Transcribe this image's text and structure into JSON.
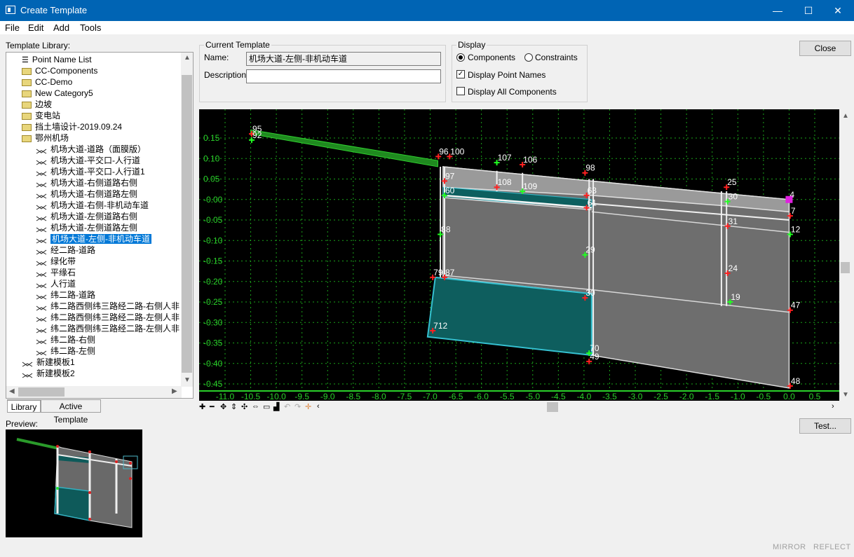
{
  "window": {
    "title": "Create Template",
    "minimize": "—",
    "maximize": "☐",
    "close": "✕"
  },
  "menu": [
    "File",
    "Edit",
    "Add",
    "Tools"
  ],
  "library": {
    "label": "Template Library:",
    "items": [
      {
        "label": "Point Name List",
        "icon": "list-icon"
      },
      {
        "label": "CC-Components",
        "icon": "folder-icon"
      },
      {
        "label": "CC-Demo",
        "icon": "folder-icon"
      },
      {
        "label": "New Category5",
        "icon": "folder-icon"
      },
      {
        "label": "边坡",
        "icon": "folder-icon"
      },
      {
        "label": "变电站",
        "icon": "folder-icon"
      },
      {
        "label": "挡土墙设计-2019.09.24",
        "icon": "folder-icon"
      },
      {
        "label": "鄂州机场",
        "icon": "folder-open-icon"
      },
      {
        "label": "机场大道-道路（面膜版）",
        "icon": "template-icon"
      },
      {
        "label": "机场大道-平交口-人行道",
        "icon": "template-icon"
      },
      {
        "label": "机场大道-平交口-人行道1",
        "icon": "template-icon"
      },
      {
        "label": "机场大道-右侧道路右侧",
        "icon": "template-icon"
      },
      {
        "label": "机场大道-右侧道路左侧",
        "icon": "template-icon"
      },
      {
        "label": "机场大道-右侧-非机动车道",
        "icon": "template-icon"
      },
      {
        "label": "机场大道-左侧道路右侧",
        "icon": "template-icon"
      },
      {
        "label": "机场大道-左侧道路左侧",
        "icon": "template-icon"
      },
      {
        "label": "机场大道-左侧-非机动车道",
        "icon": "template-icon",
        "selected": true
      },
      {
        "label": "经二路-道路",
        "icon": "template-icon"
      },
      {
        "label": "绿化带",
        "icon": "template-icon"
      },
      {
        "label": "平缘石",
        "icon": "template-icon"
      },
      {
        "label": "人行道",
        "icon": "template-icon"
      },
      {
        "label": "纬二路-道路",
        "icon": "template-icon"
      },
      {
        "label": "纬二路西侧纬三路经二路-右侧人非",
        "icon": "template-icon"
      },
      {
        "label": "纬二路西侧纬三路经二路-左侧人非",
        "icon": "template-icon"
      },
      {
        "label": "纬二路西侧纬三路经二路-左侧人非",
        "icon": "template-icon"
      },
      {
        "label": "纬二路-右侧",
        "icon": "template-icon"
      },
      {
        "label": "纬二路-左侧",
        "icon": "template-icon"
      },
      {
        "label": "新建模板1",
        "icon": "template-icon"
      },
      {
        "label": "新建模板2",
        "icon": "template-icon"
      }
    ]
  },
  "tabs": {
    "library": "Library",
    "active": "Active Template"
  },
  "current_template": {
    "title": "Current Template",
    "name_label": "Name:",
    "name_value": "机场大道-左侧-非机动车道",
    "desc_label": "Description:",
    "desc_value": ""
  },
  "display": {
    "title": "Display",
    "components": "Components",
    "constraints": "Constraints",
    "point_names": "Display Point Names",
    "all_components": "Display All Components"
  },
  "buttons": {
    "close": "Close",
    "test": "Test..."
  },
  "preview_label": "Preview:",
  "footer": {
    "mirror": "MIRROR",
    "reflect": "REFLECT"
  },
  "axes": {
    "x_ticks": [
      "-11.0",
      "-10.5",
      "-10.0",
      "-9.5",
      "-9.0",
      "-8.5",
      "-8.0",
      "-7.5",
      "-7.0",
      "-6.5",
      "-6.0",
      "-5.5",
      "-5.0",
      "-4.5",
      "-4.0",
      "-3.5",
      "-3.0",
      "-2.5",
      "-2.0",
      "-1.5",
      "-1.0",
      "-0.5",
      "0.0",
      "0.5"
    ],
    "y_ticks": [
      "0.15",
      "0.10",
      "0.05",
      "-0.00",
      "-0.05",
      "-0.10",
      "-0.15",
      "-0.20",
      "-0.25",
      "-0.30",
      "-0.35",
      "-0.40",
      "-0.45"
    ]
  },
  "point_labels": [
    {
      "text": "95",
      "x": -10.48,
      "y": 0.16
    },
    {
      "text": "92",
      "x": -10.48,
      "y": 0.145
    },
    {
      "text": "96",
      "x": -6.84,
      "y": 0.105
    },
    {
      "text": "100",
      "x": -6.62,
      "y": 0.105
    },
    {
      "text": "107",
      "x": -5.7,
      "y": 0.09
    },
    {
      "text": "106",
      "x": -5.2,
      "y": 0.085
    },
    {
      "text": "108",
      "x": -5.7,
      "y": 0.03
    },
    {
      "text": "109",
      "x": -5.2,
      "y": 0.02
    },
    {
      "text": "98",
      "x": -3.98,
      "y": 0.065
    },
    {
      "text": "97",
      "x": -6.72,
      "y": 0.045
    },
    {
      "text": "60",
      "x": -6.72,
      "y": 0.01
    },
    {
      "text": "63",
      "x": -3.95,
      "y": 0.01
    },
    {
      "text": "61",
      "x": -3.95,
      "y": -0.02
    },
    {
      "text": "88",
      "x": -6.8,
      "y": -0.085
    },
    {
      "text": "79",
      "x": -6.95,
      "y": -0.19
    },
    {
      "text": "87",
      "x": -6.72,
      "y": -0.19
    },
    {
      "text": "29",
      "x": -3.98,
      "y": -0.135
    },
    {
      "text": "30",
      "x": -3.98,
      "y": -0.24
    },
    {
      "text": "712",
      "x": -6.95,
      "y": -0.32
    },
    {
      "text": "70",
      "x": -3.9,
      "y": -0.375
    },
    {
      "text": "49",
      "x": -3.9,
      "y": -0.395
    },
    {
      "text": "25",
      "x": -1.22,
      "y": 0.03
    },
    {
      "text": "30",
      "x": -1.2,
      "y": -0.005
    },
    {
      "text": "31",
      "x": -1.2,
      "y": -0.065
    },
    {
      "text": "24",
      "x": -1.2,
      "y": -0.18
    },
    {
      "text": "19",
      "x": -1.15,
      "y": -0.25
    },
    {
      "text": "4",
      "x": 0.0,
      "y": 0.0
    },
    {
      "text": "7",
      "x": 0.02,
      "y": -0.04
    },
    {
      "text": "12",
      "x": 0.02,
      "y": -0.085
    },
    {
      "text": "47",
      "x": 0.02,
      "y": -0.27
    },
    {
      "text": "48",
      "x": 0.02,
      "y": -0.455
    }
  ]
}
